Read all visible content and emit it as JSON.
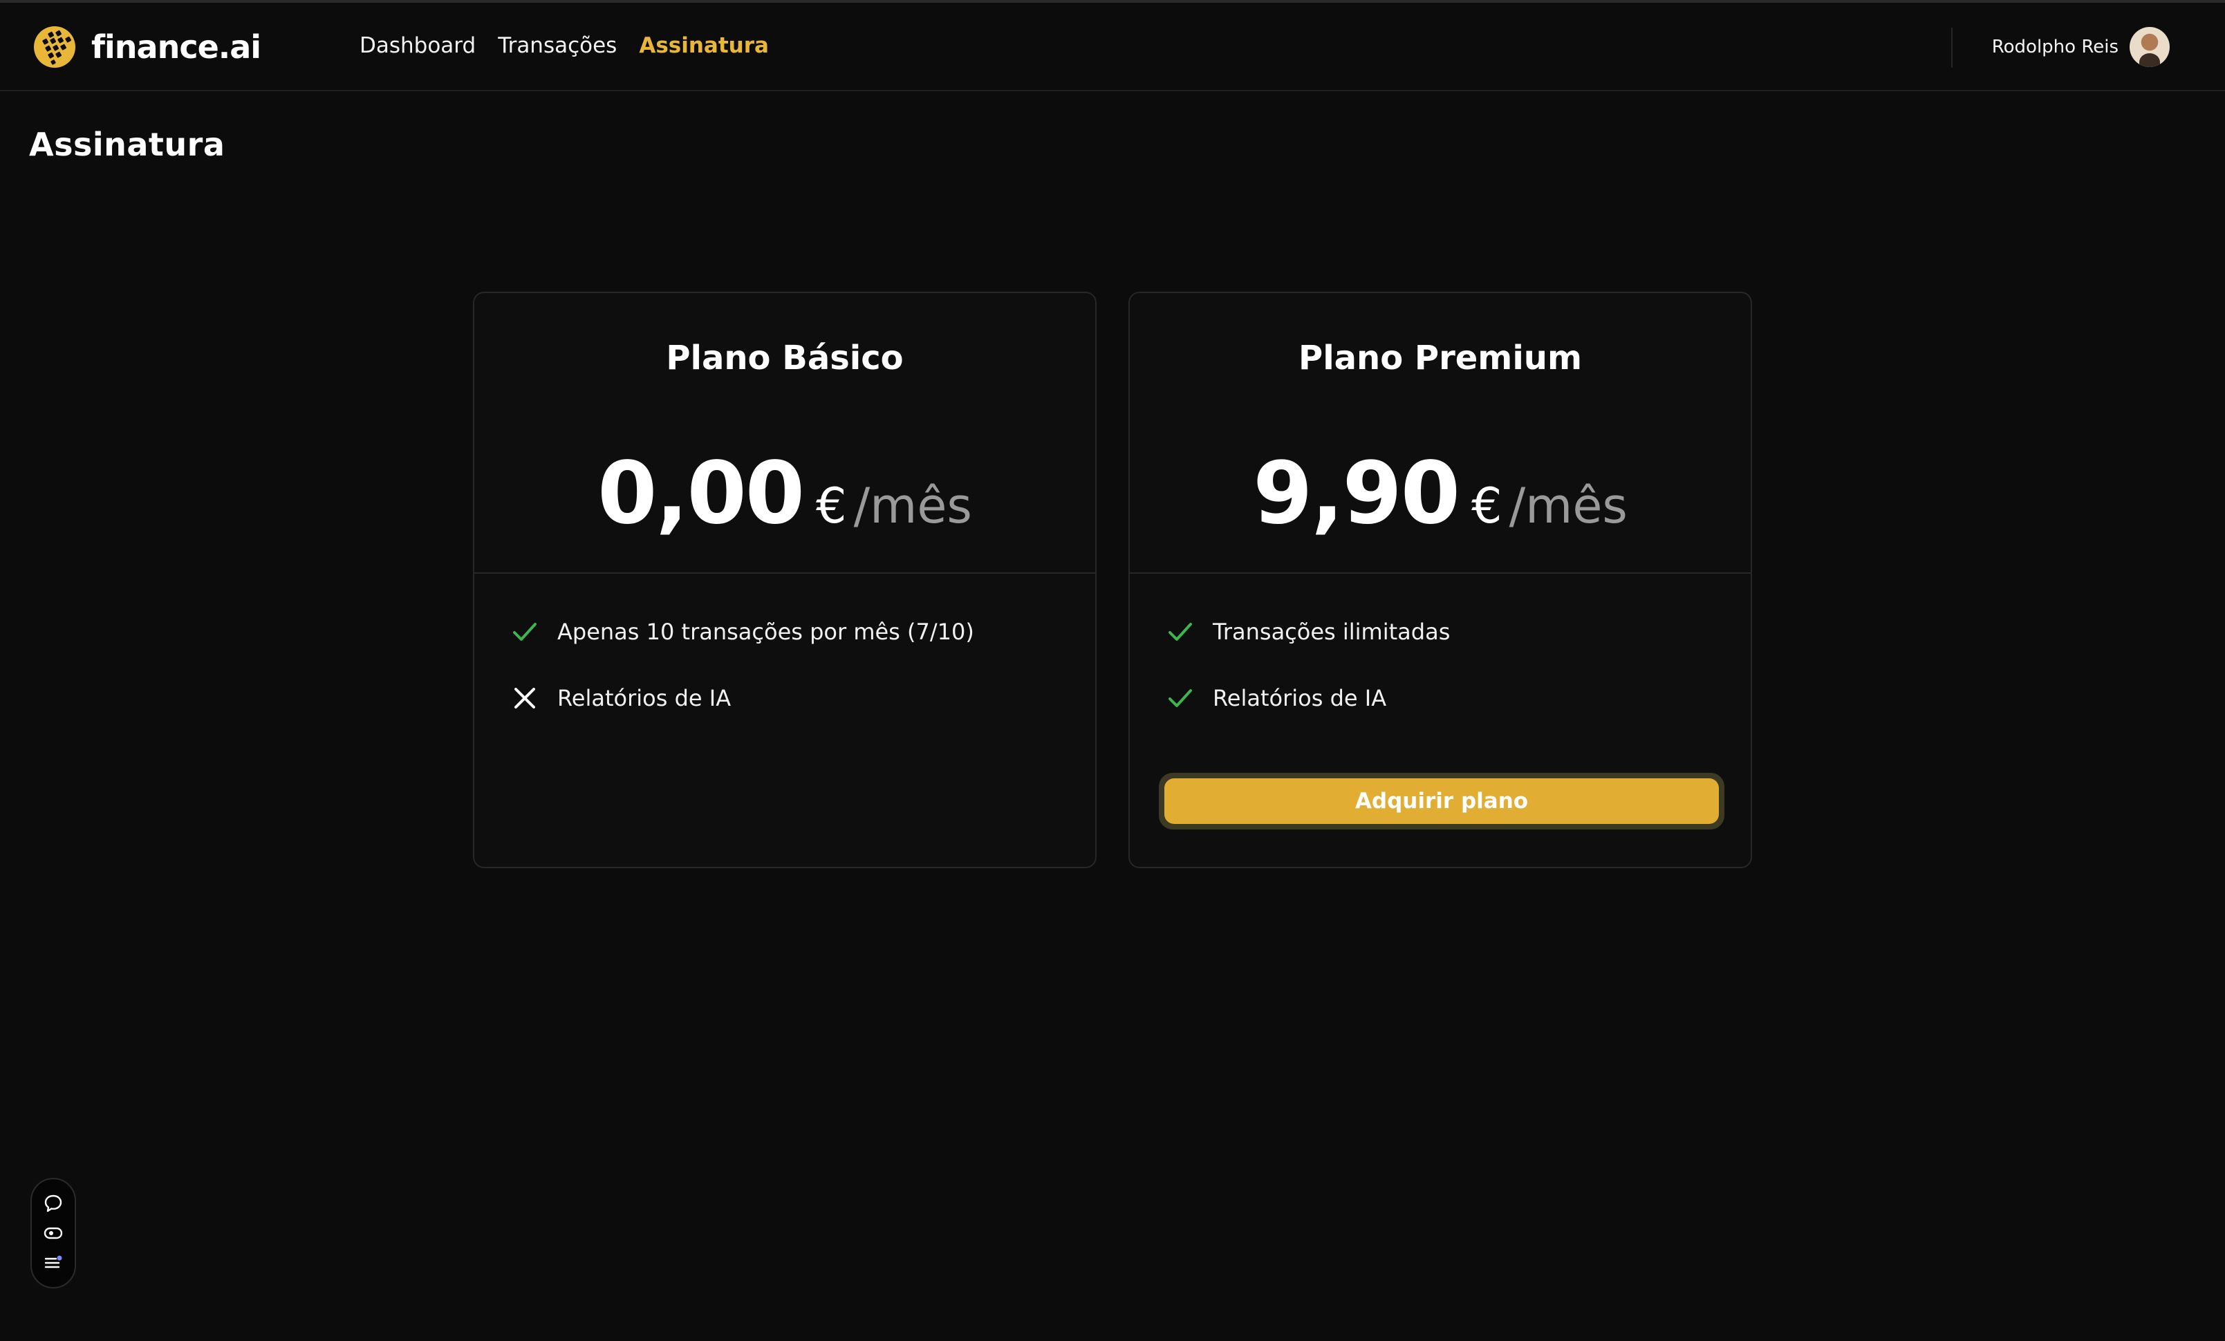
{
  "app": {
    "logo_text": "finance.ai",
    "logo_icon": "coin-grid-icon",
    "brand_color": "#e8b73a"
  },
  "nav": {
    "links": [
      {
        "label": "Dashboard",
        "active": false
      },
      {
        "label": "Transações",
        "active": false
      },
      {
        "label": "Assinatura",
        "active": true
      }
    ]
  },
  "user": {
    "name": "Rodolpho Reis",
    "avatar_icon": "user-avatar"
  },
  "page": {
    "title": "Assinatura"
  },
  "plans": [
    {
      "title": "Plano Básico",
      "price": "0,00",
      "currency": "€",
      "period": "/mês",
      "features": [
        {
          "text": "Apenas 10 transações por mês (7/10)",
          "included": true,
          "icon": "check-icon"
        },
        {
          "text": "Relatórios de IA",
          "included": false,
          "icon": "x-icon"
        }
      ]
    },
    {
      "title": "Plano Premium",
      "price": "9,90",
      "currency": "€",
      "period": "/mês",
      "features": [
        {
          "text": "Transações ilimitadas",
          "included": true,
          "icon": "check-icon"
        },
        {
          "text": "Relatórios de IA",
          "included": true,
          "icon": "check-icon"
        }
      ],
      "button_label": "Adquirir plano"
    }
  ],
  "colors": {
    "check": "#3fb44f",
    "cross": "#ffffff",
    "button": "#e1ad32",
    "background": "#0c0c0c"
  },
  "floating_toolbar": {
    "icons": [
      "chat-icon",
      "eye-icon",
      "list-icon"
    ]
  }
}
